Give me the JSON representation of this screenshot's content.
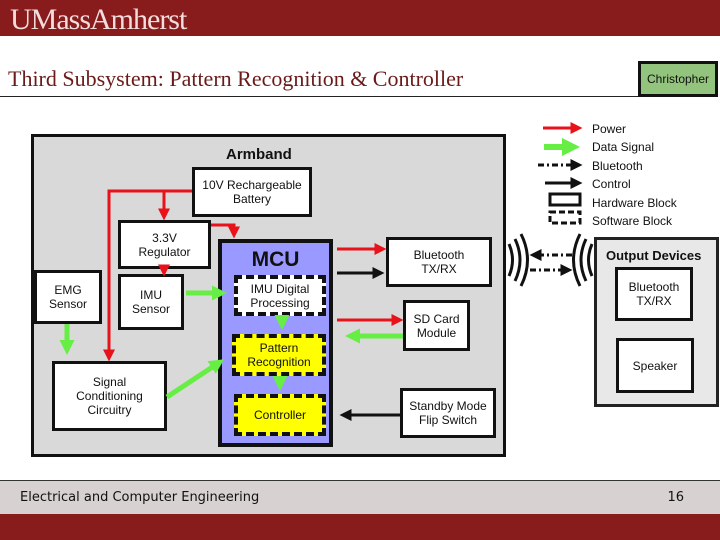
{
  "header": {
    "brand": "UMassAmherst",
    "title": "Third Subsystem: Pattern Recognition & Controller",
    "owner": "Christopher"
  },
  "legend": [
    {
      "label": "Power",
      "style": "red-arrow",
      "color": "#e8121b"
    },
    {
      "label": "Data Signal",
      "style": "green-arrow",
      "color": "#66ee44"
    },
    {
      "label": "Bluetooth",
      "style": "dash-dot-arrow"
    },
    {
      "label": "Control",
      "style": "black-arrow"
    },
    {
      "label": "Hardware Block",
      "style": "solid-box"
    },
    {
      "label": "Software Block",
      "style": "dashed-box"
    }
  ],
  "armband": {
    "label": "Armband",
    "battery": "10V Rechargeable Battery",
    "regulator": "3.3V Regulator",
    "emg": "EMG Sensor",
    "imu": "IMU Sensor",
    "signal_conditioning": "Signal Conditioning Circuitry",
    "mcu": {
      "label": "MCU",
      "imu_processing": "IMU Digital Processing",
      "pattern_recognition": "Pattern Recognition",
      "controller": "Controller"
    },
    "bluetooth": "Bluetooth TX/RX",
    "sd_card": "SD Card Module",
    "standby": "Standby Mode Flip Switch"
  },
  "output_devices": {
    "label": "Output Devices",
    "bluetooth": "Bluetooth TX/RX",
    "speaker": "Speaker"
  },
  "colors": {
    "power": "#e8121b",
    "data": "#66ee44",
    "mcu": "#9999ff",
    "software_block": "#ffff00",
    "brand": "#881c1c"
  },
  "footer": {
    "department": "Electrical and Computer Engineering",
    "page": "16"
  }
}
